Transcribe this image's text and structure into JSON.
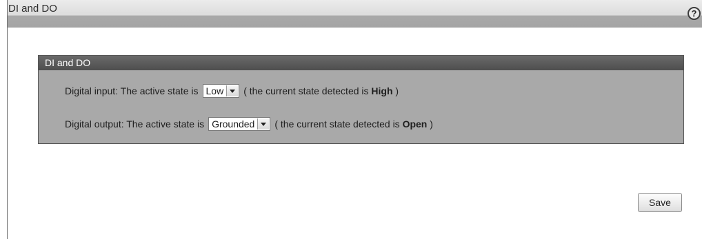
{
  "window": {
    "title": "DI and DO",
    "help_icon": "help-icon",
    "help_glyph": "?"
  },
  "panel": {
    "title": "DI and DO",
    "digital_input": {
      "prefix": "Digital input: The active state is",
      "selected": "Low",
      "suffix_start": "( the current state detected is",
      "current_state": "High",
      "suffix_end": ")"
    },
    "digital_output": {
      "prefix": "Digital output: The active state is",
      "selected": "Grounded",
      "suffix_start": "( the current state detected is",
      "current_state": "Open",
      "suffix_end": ")"
    }
  },
  "actions": {
    "save_label": "Save"
  }
}
